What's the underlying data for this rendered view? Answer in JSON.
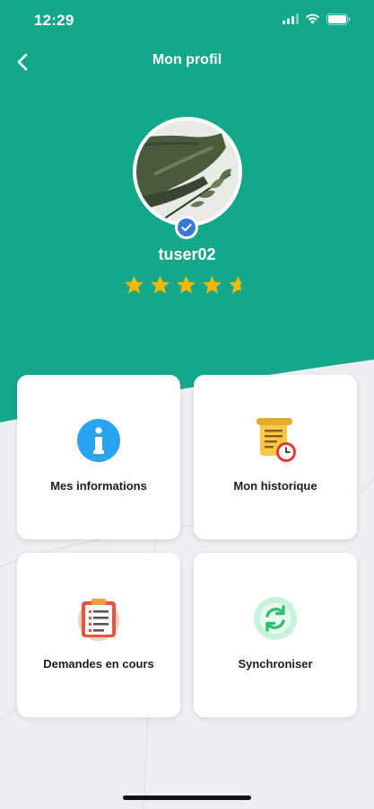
{
  "status_bar": {
    "time": "12:29"
  },
  "header": {
    "title": "Mon profil"
  },
  "profile": {
    "username": "tuser02",
    "rating": 4.5,
    "rating_max": 5
  },
  "cards": [
    {
      "label": "Mes informations",
      "icon": "info-icon"
    },
    {
      "label": "Mon historique",
      "icon": "history-scroll-icon"
    },
    {
      "label": "Demandes en cours",
      "icon": "clipboard-list-icon"
    },
    {
      "label": "Synchroniser",
      "icon": "sync-icon"
    }
  ],
  "colors": {
    "primary": "#14a88b",
    "background": "#eceef1",
    "star": "#f5b800",
    "accent_blue": "#2aa3f0"
  }
}
